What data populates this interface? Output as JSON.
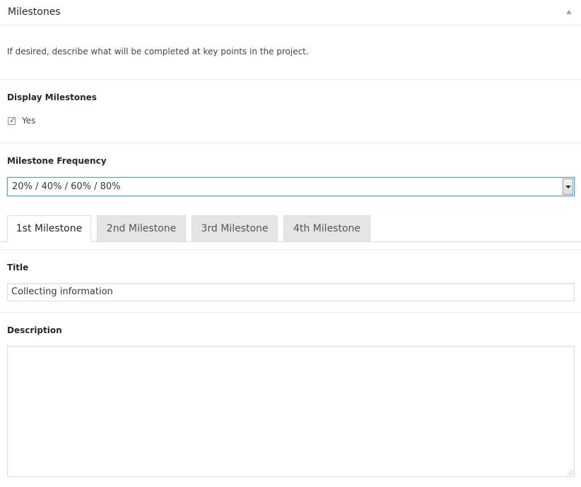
{
  "header": {
    "title": "Milestones",
    "collapse_icon": "triangle-up-icon"
  },
  "intro": "If desired, describe what will be completed at key points in the project.",
  "display_milestones": {
    "label": "Display Milestones",
    "checkbox_label": "Yes",
    "checked": true
  },
  "frequency": {
    "label": "Milestone Frequency",
    "selected": "20% / 40% / 60% / 80%"
  },
  "tabs": [
    {
      "label": "1st Milestone",
      "active": true
    },
    {
      "label": "2nd Milestone",
      "active": false
    },
    {
      "label": "3rd Milestone",
      "active": false
    },
    {
      "label": "4th Milestone",
      "active": false
    }
  ],
  "title_field": {
    "label": "Title",
    "value": "Collecting information"
  },
  "description_field": {
    "label": "Description",
    "value": ""
  },
  "colors": {
    "focus_border": "#5b9dd9",
    "checkmark": "#1e5fbf",
    "inactive_tab_bg": "#e5e5e5"
  }
}
